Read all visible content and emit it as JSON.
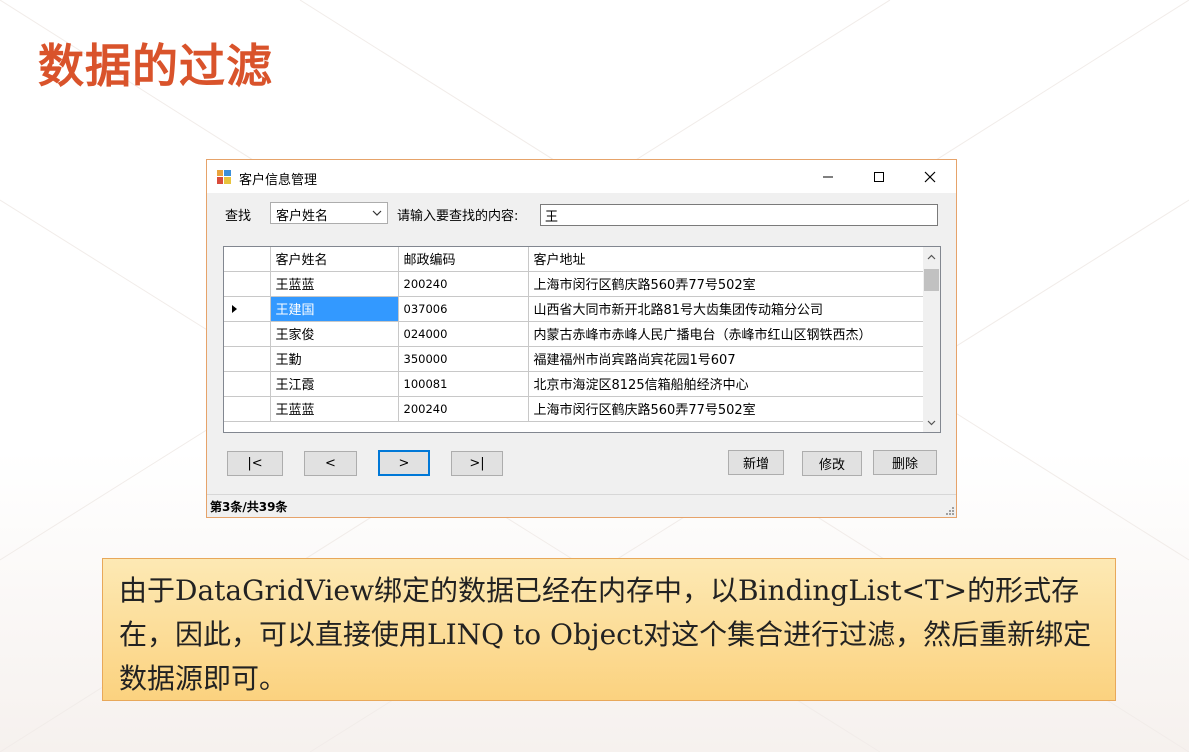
{
  "slide": {
    "title": "数据的过滤"
  },
  "window": {
    "title": "客户信息管理",
    "minimize": "–",
    "maximize": "☐",
    "close": "✕",
    "find_label": "查找",
    "field_select": "客户姓名",
    "input_label": "请输入要查找的内容:",
    "search_value": "王"
  },
  "grid": {
    "columns": [
      "客户姓名",
      "邮政编码",
      "客户地址"
    ],
    "rows": [
      {
        "name": "王蓝蓝",
        "postcode": "200240",
        "address": "上海市闵行区鹤庆路560弄77号502室"
      },
      {
        "name": "王建国",
        "postcode": "037006",
        "address": "山西省大同市新开北路81号大齿集团传动箱分公司"
      },
      {
        "name": "王家俊",
        "postcode": "024000",
        "address": "内蒙古赤峰市赤峰人民广播电台（赤峰市红山区钢铁西杰）"
      },
      {
        "name": "王勤",
        "postcode": "350000",
        "address": "福建福州市尚宾路尚宾花园1号607"
      },
      {
        "name": "王江霞",
        "postcode": "100081",
        "address": "北京市海淀区8125信箱船舶经济中心"
      },
      {
        "name": "王蓝蓝",
        "postcode": "200240",
        "address": "上海市闵行区鹤庆路560弄77号502室"
      }
    ]
  },
  "nav": {
    "first": "|<",
    "prev": "<",
    "next": ">",
    "last": ">|"
  },
  "actions": {
    "add": "新增",
    "edit": "修改",
    "delete": "删除"
  },
  "status": "第3条/共39条",
  "note": "由于DataGridView绑定的数据已经在内存中，以BindingList<T>的形式存在，因此，可以直接使用LINQ to Object对这个集合进行过滤，然后重新绑定数据源即可。",
  "colors": {
    "title": "#d9532b",
    "selection": "#3399ff",
    "note_bg": "#fbd27f",
    "note_border": "#e8a85a"
  }
}
